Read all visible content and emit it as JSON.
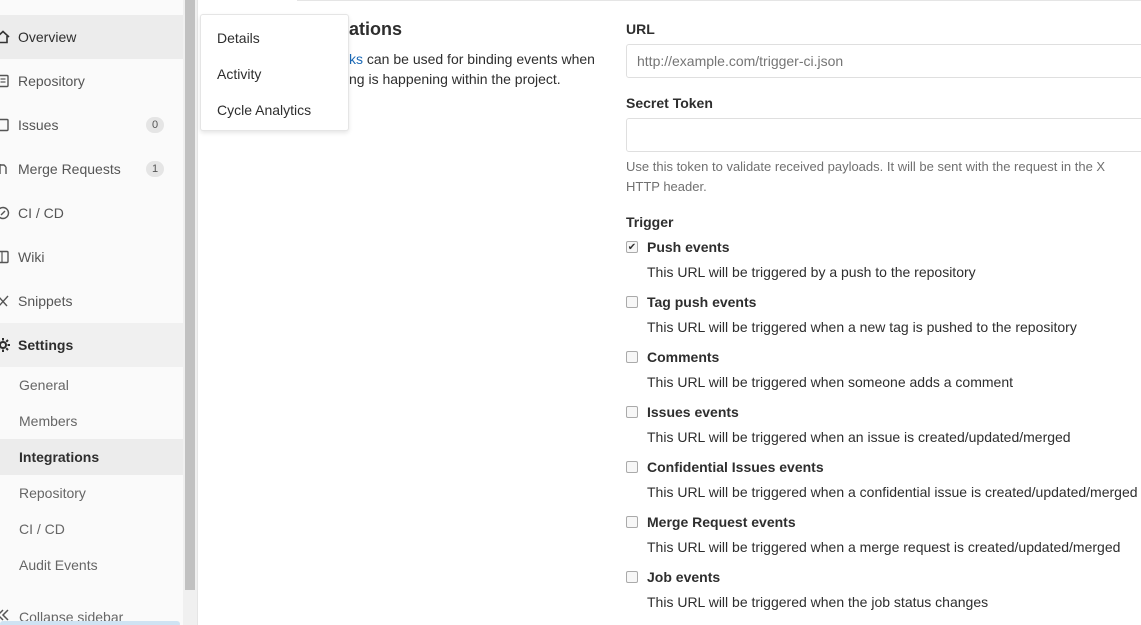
{
  "sidebar": {
    "items": [
      {
        "label": "Overview",
        "icon": "home-icon",
        "active": true
      },
      {
        "label": "Repository",
        "icon": "book-icon"
      },
      {
        "label": "Issues",
        "icon": "issues-icon",
        "badge": "0"
      },
      {
        "label": "Merge Requests",
        "icon": "merge-request-icon",
        "badge": "1"
      },
      {
        "label": "CI / CD",
        "icon": "rocket-icon"
      },
      {
        "label": "Wiki",
        "icon": "wiki-icon"
      },
      {
        "label": "Snippets",
        "icon": "scissors-icon"
      },
      {
        "label": "Settings",
        "icon": "gear-icon"
      }
    ],
    "settings_items": [
      {
        "label": "General"
      },
      {
        "label": "Members"
      },
      {
        "label": "Integrations",
        "active": true
      },
      {
        "label": "Repository"
      },
      {
        "label": "CI / CD"
      },
      {
        "label": "Audit Events"
      }
    ],
    "collapse_label": "Collapse sidebar"
  },
  "dropdown": {
    "items": [
      "Details",
      "Activity",
      "Cycle Analytics"
    ]
  },
  "section": {
    "title": "ations",
    "desc_link": "ks",
    "desc_line1": " can be used for binding events when",
    "desc_line2": "ng is happening within the project."
  },
  "form": {
    "url_label": "URL",
    "url_placeholder": "http://example.com/trigger-ci.json",
    "token_label": "Secret Token",
    "token_help_1": "Use this token to validate received payloads. It will be sent with the request in the X",
    "token_help_2": "HTTP header.",
    "trigger_label": "Trigger",
    "triggers": [
      {
        "label": "Push events",
        "help": "This URL will be triggered by a push to the repository",
        "checked": true
      },
      {
        "label": "Tag push events",
        "help": "This URL will be triggered when a new tag is pushed to the repository",
        "checked": false
      },
      {
        "label": "Comments",
        "help": "This URL will be triggered when someone adds a comment",
        "checked": false
      },
      {
        "label": "Issues events",
        "help": "This URL will be triggered when an issue is created/updated/merged",
        "checked": false
      },
      {
        "label": "Confidential Issues events",
        "help": "This URL will be triggered when a confidential issue is created/updated/merged",
        "checked": false
      },
      {
        "label": "Merge Request events",
        "help": "This URL will be triggered when a merge request is created/updated/merged",
        "checked": false
      },
      {
        "label": "Job events",
        "help": "This URL will be triggered when the job status changes",
        "checked": false
      }
    ]
  },
  "colors": {
    "link": "#1b69b6",
    "sidebar_bg": "#fafafa",
    "active_bg": "#ececec"
  }
}
